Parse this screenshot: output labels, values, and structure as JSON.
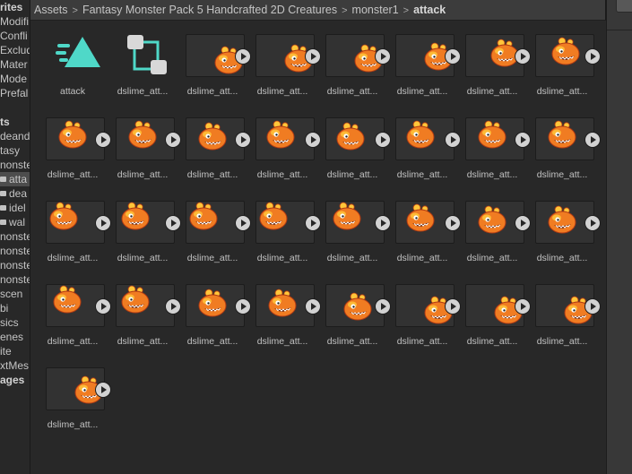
{
  "window": {
    "breadcrumb": [
      {
        "label": "Assets"
      },
      {
        "label": "Fantasy Monster Pack 5 Handcrafted 2D Creatures"
      },
      {
        "label": "monster1"
      },
      {
        "label": "attack",
        "current": true
      }
    ]
  },
  "tree": {
    "items": [
      {
        "label": "rites",
        "bold": true
      },
      {
        "label": "Modifi"
      },
      {
        "label": "Confli"
      },
      {
        "label": "Exclud"
      },
      {
        "label": "Mater"
      },
      {
        "label": "Mode"
      },
      {
        "label": "Prefal"
      },
      {
        "label": ""
      },
      {
        "label": "ts",
        "bold": true
      },
      {
        "label": "deand"
      },
      {
        "label": "tasy"
      },
      {
        "label": "nonste"
      },
      {
        "label": "atta",
        "folder": true,
        "selected": true
      },
      {
        "label": "dea",
        "folder": true
      },
      {
        "label": "idel",
        "folder": true
      },
      {
        "label": "wal",
        "folder": true
      },
      {
        "label": "nonste"
      },
      {
        "label": "nonste"
      },
      {
        "label": "nonste"
      },
      {
        "label": "nonste"
      },
      {
        "label": "scen"
      },
      {
        "label": "bi"
      },
      {
        "label": "sics"
      },
      {
        "label": "enes"
      },
      {
        "label": "ite"
      },
      {
        "label": "xtMes"
      },
      {
        "label": "ages",
        "bold": true
      }
    ]
  },
  "grid": {
    "items": [
      {
        "label": "attack",
        "kind": "animation-clip",
        "icon": "animation-clip-icon"
      },
      {
        "label": "dslime_att...",
        "kind": "animator-controller",
        "icon": "animator-controller-icon"
      },
      {
        "label": "dslime_att...",
        "kind": "sprite",
        "frame": 1
      },
      {
        "label": "dslime_att...",
        "kind": "sprite",
        "frame": 2
      },
      {
        "label": "dslime_att...",
        "kind": "sprite",
        "frame": 3
      },
      {
        "label": "dslime_att...",
        "kind": "sprite",
        "frame": 4
      },
      {
        "label": "dslime_att...",
        "kind": "sprite",
        "frame": 5
      },
      {
        "label": "dslime_att...",
        "kind": "sprite",
        "frame": 6
      },
      {
        "label": "dslime_att...",
        "kind": "sprite",
        "frame": 7
      },
      {
        "label": "dslime_att...",
        "kind": "sprite",
        "frame": 8
      },
      {
        "label": "dslime_att...",
        "kind": "sprite",
        "frame": 9
      },
      {
        "label": "dslime_att...",
        "kind": "sprite",
        "frame": 10
      },
      {
        "label": "dslime_att...",
        "kind": "sprite",
        "frame": 11
      },
      {
        "label": "dslime_att...",
        "kind": "sprite",
        "frame": 12
      },
      {
        "label": "dslime_att...",
        "kind": "sprite",
        "frame": 13
      },
      {
        "label": "dslime_att...",
        "kind": "sprite",
        "frame": 14
      },
      {
        "label": "dslime_att...",
        "kind": "sprite",
        "frame": 15
      },
      {
        "label": "dslime_att...",
        "kind": "sprite",
        "frame": 16
      },
      {
        "label": "dslime_att...",
        "kind": "sprite",
        "frame": 17
      },
      {
        "label": "dslime_att...",
        "kind": "sprite",
        "frame": 18
      },
      {
        "label": "dslime_att...",
        "kind": "sprite",
        "frame": 19
      },
      {
        "label": "dslime_att...",
        "kind": "sprite",
        "frame": 20
      },
      {
        "label": "dslime_att...",
        "kind": "sprite",
        "frame": 21
      },
      {
        "label": "dslime_att...",
        "kind": "sprite",
        "frame": 22
      },
      {
        "label": "dslime_att...",
        "kind": "sprite",
        "frame": 23
      },
      {
        "label": "dslime_att...",
        "kind": "sprite",
        "frame": 24
      },
      {
        "label": "dslime_att...",
        "kind": "sprite",
        "frame": 25
      },
      {
        "label": "dslime_att...",
        "kind": "sprite",
        "frame": 26
      },
      {
        "label": "dslime_att...",
        "kind": "sprite",
        "frame": 27
      },
      {
        "label": "dslime_att...",
        "kind": "sprite",
        "frame": 28
      },
      {
        "label": "dslime_att...",
        "kind": "sprite",
        "frame": 29
      },
      {
        "label": "dslime_att...",
        "kind": "sprite",
        "frame": 30
      },
      {
        "label": "dslime_att...",
        "kind": "sprite",
        "frame": 31
      }
    ]
  },
  "colors": {
    "anim_icon": "#4fd8c8",
    "controller_icon": "#d8d8d8",
    "slime_body": "#f07c22",
    "slime_highlight": "#ffc63a",
    "slime_dark": "#b23a12"
  }
}
